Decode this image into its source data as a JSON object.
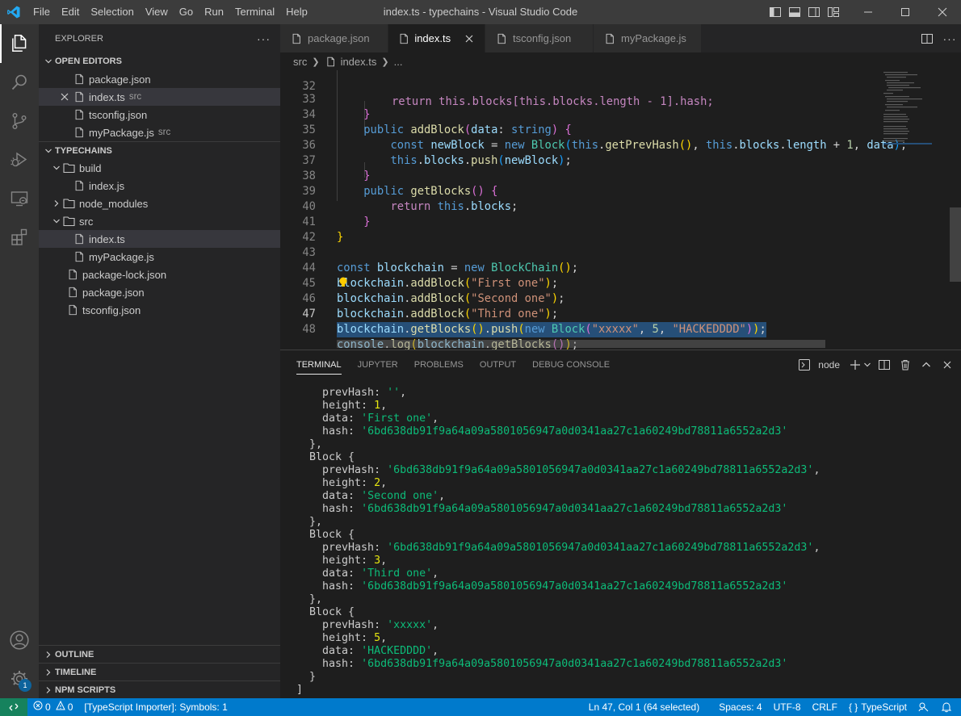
{
  "titlebar": {
    "title": "index.ts - typechains - Visual Studio Code",
    "menu": [
      "File",
      "Edit",
      "Selection",
      "View",
      "Go",
      "Run",
      "Terminal",
      "Help"
    ]
  },
  "activitybar": {
    "icons": [
      "explorer-icon",
      "search-icon",
      "source-control-icon",
      "run-debug-icon",
      "remote-explorer-icon",
      "extensions-icon",
      "account-icon",
      "manage-gear-icon"
    ],
    "manage_badge": "1"
  },
  "sidebar": {
    "header": "EXPLORER",
    "open_editors_title": "OPEN EDITORS",
    "open_editors": [
      {
        "name": "package.json",
        "desc": ""
      },
      {
        "name": "index.ts",
        "desc": "src"
      },
      {
        "name": "tsconfig.json",
        "desc": ""
      },
      {
        "name": "myPackage.js",
        "desc": "src"
      }
    ],
    "project_title": "TYPECHAINS",
    "tree": {
      "build": "build",
      "build_index": "index.js",
      "node_modules": "node_modules",
      "src": "src",
      "src_index": "index.ts",
      "src_mypackage": "myPackage.js",
      "package_lock": "package-lock.json",
      "package": "package.json",
      "tsconfig": "tsconfig.json"
    },
    "outline": "OUTLINE",
    "timeline": "TIMELINE",
    "npm_scripts": "NPM SCRIPTS"
  },
  "tabs": [
    {
      "label": "package.json"
    },
    {
      "label": "index.ts"
    },
    {
      "label": "tsconfig.json"
    },
    {
      "label": "myPackage.js"
    }
  ],
  "breadcrumb": {
    "folder": "src",
    "file": "index.ts",
    "symbol": "..."
  },
  "editor": {
    "line_numbers": [
      "32",
      "33",
      "34",
      "35",
      "36",
      "37",
      "38",
      "39",
      "40",
      "41",
      "42",
      "43",
      "44",
      "45",
      "46",
      "47",
      "48"
    ],
    "current_line": "47",
    "line_32_partial": "return this.blocks[this.blocks.length - 1].hash;"
  },
  "panel": {
    "tabs": [
      "TERMINAL",
      "JUPYTER",
      "PROBLEMS",
      "OUTPUT",
      "DEBUG CONSOLE"
    ],
    "terminal_name": "node",
    "terminal_lines": [
      "    prevHash: '',",
      "    height: 1,",
      "    data: 'First one',",
      "    hash: '6bd638db91f9a64a09a5801056947a0d0341aa27c1a60249bd78811a6552a2d3'",
      "  },",
      "  Block {",
      "    prevHash: '6bd638db91f9a64a09a5801056947a0d0341aa27c1a60249bd78811a6552a2d3',",
      "    height: 2,",
      "    data: 'Second one',",
      "    hash: '6bd638db91f9a64a09a5801056947a0d0341aa27c1a60249bd78811a6552a2d3'",
      "  },",
      "  Block {",
      "    prevHash: '6bd638db91f9a64a09a5801056947a0d0341aa27c1a60249bd78811a6552a2d3',",
      "    height: 3,",
      "    data: 'Third one',",
      "    hash: '6bd638db91f9a64a09a5801056947a0d0341aa27c1a60249bd78811a6552a2d3'",
      "  },",
      "  Block {",
      "    prevHash: 'xxxxx',",
      "    height: 5,",
      "    data: 'HACKEDDDD',",
      "    hash: '6bd638db91f9a64a09a5801056947a0d0341aa27c1a60249bd78811a6552a2d3'",
      "  }",
      "]"
    ]
  },
  "statusbar": {
    "errors": "0",
    "warnings": "0",
    "importer": "[TypeScript Importer]: Symbols: 1",
    "position": "Ln 47, Col 1 (64 selected)",
    "spaces": "Spaces: 4",
    "encoding": "UTF-8",
    "eol": "CRLF",
    "language_braces": "{ }",
    "language": "TypeScript"
  },
  "colors": {
    "statusbar": "#007acc",
    "remote": "#16825d",
    "selection": "#264f78"
  }
}
